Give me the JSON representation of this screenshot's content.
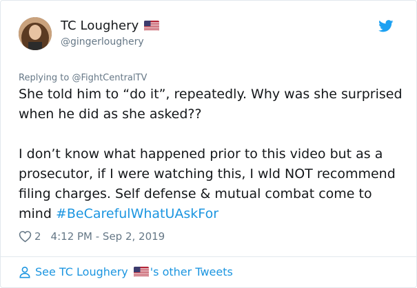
{
  "tweet": {
    "display_name": "TC Loughery",
    "handle": "@gingerloughery",
    "replying_prefix": "Replying to",
    "replying_to": "@FightCentralTV",
    "paragraph1": "She told him to “do it”, repeatedly. Why was she surprised when he did as she asked??",
    "paragraph2_text": "I don’t know what happened prior to this video but as a prosecutor, if I were watching this, I wld NOT recommend filing charges. Self defense & mutual combat come to mind",
    "hashtag": "#BeCarefulWhatUAskFor",
    "like_count": "2",
    "timestamp": "4:12 PM - Sep 2, 2019"
  },
  "footer": {
    "see_prefix": "See TC Loughery",
    "see_suffix": "'s other Tweets"
  },
  "colors": {
    "link": "#1b95e0",
    "muted": "#657786",
    "text": "#14171a",
    "border": "#e1e8ed"
  },
  "icons": {
    "avatar": "avatar",
    "flag": "us-flag-icon",
    "brand": "twitter-bird-icon",
    "like": "heart-icon",
    "profile": "person-icon"
  }
}
